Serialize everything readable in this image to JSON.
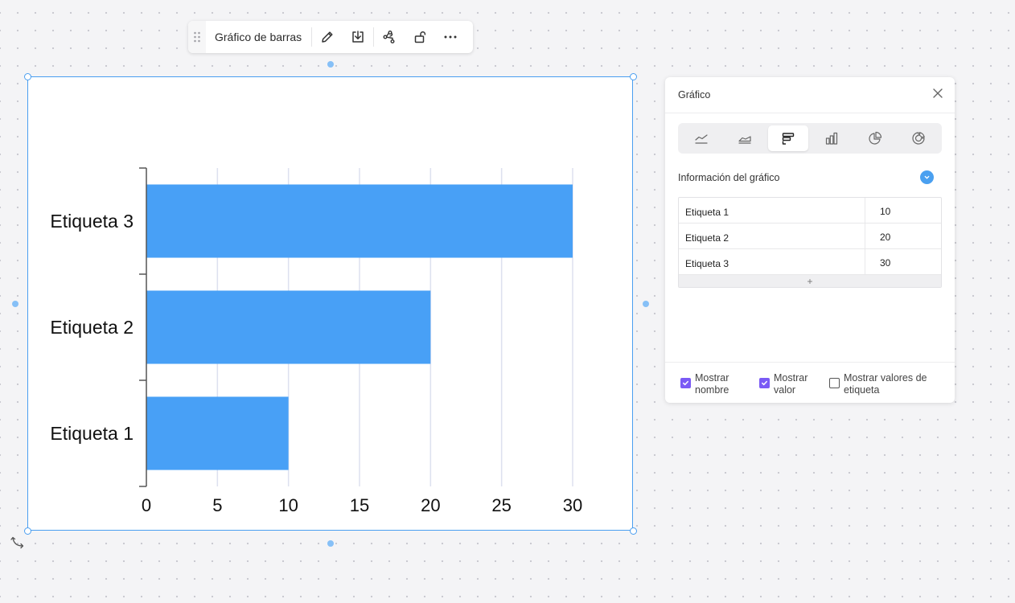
{
  "toolbar": {
    "title": "Gráfico de barras",
    "icons": [
      "drag-handle",
      "pencil",
      "download",
      "connect-nodes",
      "unlock",
      "more-horizontal"
    ]
  },
  "chart_data": {
    "type": "bar",
    "orientation": "horizontal",
    "categories": [
      "Etiqueta 1",
      "Etiqueta 2",
      "Etiqueta 3"
    ],
    "values": [
      10,
      20,
      30
    ],
    "xlim": [
      0,
      30
    ],
    "xticks": [
      "0",
      "5",
      "10",
      "15",
      "20",
      "25",
      "30"
    ],
    "grid": true,
    "bar_color": "#48a0f6",
    "grid_color": "#dde1ef"
  },
  "panel": {
    "title": "Gráfico",
    "chart_types": [
      "line-chart-icon",
      "area-chart-icon",
      "horizontal-bar-chart-icon",
      "column-chart-icon",
      "pie-chart-icon",
      "donut-chart-icon"
    ],
    "active_type": 2,
    "section_title": "Información del gráfico",
    "rows": [
      {
        "label": "Etiqueta 1",
        "value": "10"
      },
      {
        "label": "Etiqueta 2",
        "value": "20"
      },
      {
        "label": "Etiqueta 3",
        "value": "30"
      }
    ],
    "add_label": "+",
    "options": [
      {
        "label": "Mostrar nombre",
        "checked": true
      },
      {
        "label": "Mostrar valor",
        "checked": true
      },
      {
        "label": "Mostrar valores de etiqueta",
        "checked": false
      }
    ]
  },
  "colors": {
    "selection": "#4a9ef0",
    "accent_checkbox": "#7a5af5",
    "toggle": "#4aa0f0"
  }
}
